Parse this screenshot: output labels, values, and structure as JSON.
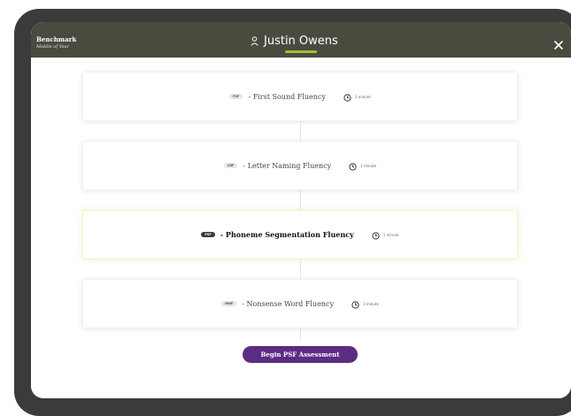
{
  "header": {
    "title": "Benchmark",
    "subtitle": "Middle of Year",
    "student_name": "Justin Owens",
    "accent_color": "#9ac23c"
  },
  "icons": {
    "student": "user-icon",
    "close": "close-icon",
    "time": "clock-icon"
  },
  "measures": [
    {
      "code": "FSF",
      "label": "- First Sound Fluency",
      "time": "1 minute",
      "active": false
    },
    {
      "code": "LNF",
      "label": "- Letter Naming Fluency",
      "time": "1 minute",
      "active": false
    },
    {
      "code": "PSF",
      "label": "- Phoneme Segmentation Fluency",
      "time": "1 minute",
      "active": true
    },
    {
      "code": "NWF",
      "label": "- Nonsense Word Fluency",
      "time": "1 minute",
      "active": false
    }
  ],
  "actions": {
    "begin_label": "Begin PSF Assessment",
    "begin_color": "#5b2c83"
  }
}
